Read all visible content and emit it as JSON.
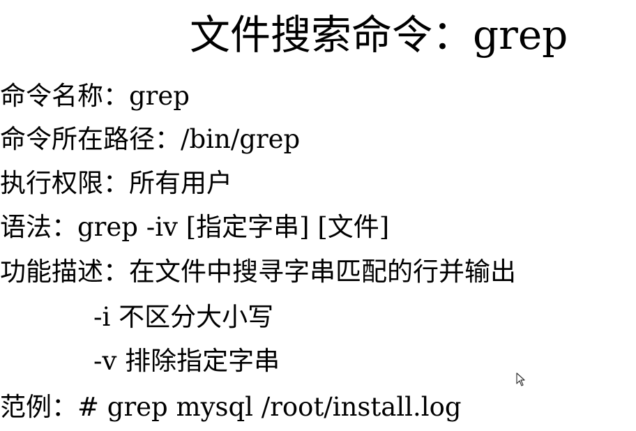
{
  "title": "文件搜索命令：grep",
  "lines": [
    "命令名称：grep",
    "命令所在路径：/bin/grep",
    "执行权限：所有用户",
    "语法：grep  -iv [指定字串] [文件]",
    "功能描述：在文件中搜寻字串匹配的行并输出",
    "-i  不区分大小写",
    "-v 排除指定字串",
    "范例：# grep  mysql  /root/install.log"
  ],
  "cursor_icon": "mouse-pointer-icon"
}
